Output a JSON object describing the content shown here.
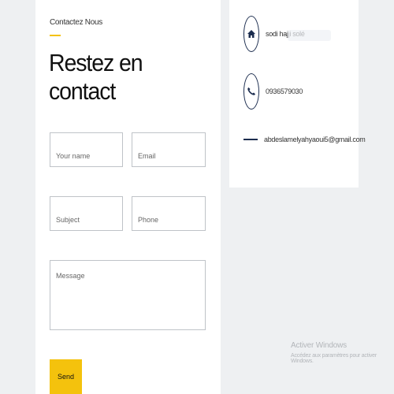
{
  "form": {
    "eyebrow": "Contactez Nous",
    "heading": "Restez en contact",
    "name_placeholder": "Your name",
    "email_placeholder": "Email",
    "subject_placeholder": "Subject",
    "phone_placeholder": "Phone",
    "message_placeholder": "Message",
    "send_label": "Send"
  },
  "info": {
    "address": "sodi hajji solé",
    "phone": "0936579030",
    "email": "abdeslamelyahyaoui5@gmail.com"
  },
  "watermark": {
    "title": "Activer Windows",
    "subtitle": "Accédez aux paramètres pour activer Windows."
  },
  "colors": {
    "accent": "#f4c20d",
    "icon_navy": "#1c2d4f",
    "background": "#eef0f2"
  },
  "icons": {
    "address": "home-icon",
    "phone": "phone-icon",
    "email": "dash-icon"
  }
}
